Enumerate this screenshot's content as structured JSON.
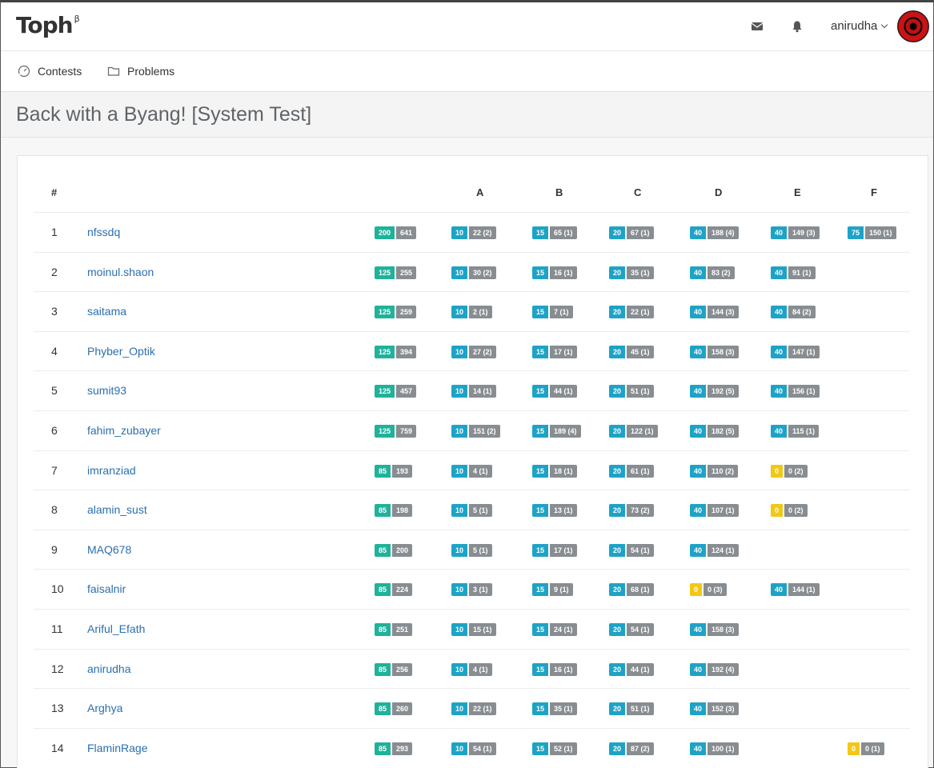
{
  "app": {
    "logo": "Toph",
    "logo_sup": "β",
    "username": "anirudha"
  },
  "nav": [
    {
      "label": "Contests",
      "icon": "gauge-icon"
    },
    {
      "label": "Problems",
      "icon": "folder-icon"
    }
  ],
  "page_title": "Back with a Byang! [System Test]",
  "table": {
    "headers": {
      "rank": "#",
      "problems": [
        "A",
        "B",
        "C",
        "D",
        "E",
        "F"
      ]
    },
    "rows": [
      {
        "rank": "1",
        "name": "nfssdq",
        "score": "200",
        "penalty": "641",
        "cells": [
          [
            "10",
            "22 (2)",
            "b"
          ],
          [
            "15",
            "65 (1)",
            "b"
          ],
          [
            "20",
            "67 (1)",
            "b"
          ],
          [
            "40",
            "188 (4)",
            "b"
          ],
          [
            "40",
            "149 (3)",
            "b"
          ],
          [
            "75",
            "150 (1)",
            "b"
          ]
        ]
      },
      {
        "rank": "2",
        "name": "moinul.shaon",
        "score": "125",
        "penalty": "255",
        "cells": [
          [
            "10",
            "30 (2)",
            "b"
          ],
          [
            "15",
            "16 (1)",
            "b"
          ],
          [
            "20",
            "35 (1)",
            "b"
          ],
          [
            "40",
            "83 (2)",
            "b"
          ],
          [
            "40",
            "91 (1)",
            "b"
          ],
          null
        ]
      },
      {
        "rank": "3",
        "name": "saitama",
        "score": "125",
        "penalty": "259",
        "cells": [
          [
            "10",
            "2 (1)",
            "b"
          ],
          [
            "15",
            "7 (1)",
            "b"
          ],
          [
            "20",
            "22 (1)",
            "b"
          ],
          [
            "40",
            "144 (3)",
            "b"
          ],
          [
            "40",
            "84 (2)",
            "b"
          ],
          null
        ]
      },
      {
        "rank": "4",
        "name": "Phyber_Optik",
        "score": "125",
        "penalty": "394",
        "cells": [
          [
            "10",
            "27 (2)",
            "b"
          ],
          [
            "15",
            "17 (1)",
            "b"
          ],
          [
            "20",
            "45 (1)",
            "b"
          ],
          [
            "40",
            "158 (3)",
            "b"
          ],
          [
            "40",
            "147 (1)",
            "b"
          ],
          null
        ]
      },
      {
        "rank": "5",
        "name": "sumit93",
        "score": "125",
        "penalty": "457",
        "cells": [
          [
            "10",
            "14 (1)",
            "b"
          ],
          [
            "15",
            "44 (1)",
            "b"
          ],
          [
            "20",
            "51 (1)",
            "b"
          ],
          [
            "40",
            "192 (5)",
            "b"
          ],
          [
            "40",
            "156 (1)",
            "b"
          ],
          null
        ]
      },
      {
        "rank": "6",
        "name": "fahim_zubayer",
        "score": "125",
        "penalty": "759",
        "cells": [
          [
            "10",
            "151 (2)",
            "b"
          ],
          [
            "15",
            "189 (4)",
            "b"
          ],
          [
            "20",
            "122 (1)",
            "b"
          ],
          [
            "40",
            "182 (5)",
            "b"
          ],
          [
            "40",
            "115 (1)",
            "b"
          ],
          null
        ]
      },
      {
        "rank": "7",
        "name": "imranziad",
        "score": "85",
        "penalty": "193",
        "cells": [
          [
            "10",
            "4 (1)",
            "b"
          ],
          [
            "15",
            "18 (1)",
            "b"
          ],
          [
            "20",
            "61 (1)",
            "b"
          ],
          [
            "40",
            "110 (2)",
            "b"
          ],
          [
            "0",
            "0 (2)",
            "y"
          ],
          null
        ]
      },
      {
        "rank": "8",
        "name": "alamin_sust",
        "score": "85",
        "penalty": "198",
        "cells": [
          [
            "10",
            "5 (1)",
            "b"
          ],
          [
            "15",
            "13 (1)",
            "b"
          ],
          [
            "20",
            "73 (2)",
            "b"
          ],
          [
            "40",
            "107 (1)",
            "b"
          ],
          [
            "0",
            "0 (2)",
            "y"
          ],
          null
        ]
      },
      {
        "rank": "9",
        "name": "MAQ678",
        "score": "85",
        "penalty": "200",
        "cells": [
          [
            "10",
            "5 (1)",
            "b"
          ],
          [
            "15",
            "17 (1)",
            "b"
          ],
          [
            "20",
            "54 (1)",
            "b"
          ],
          [
            "40",
            "124 (1)",
            "b"
          ],
          null,
          null
        ]
      },
      {
        "rank": "10",
        "name": "faisalnir",
        "score": "85",
        "penalty": "224",
        "cells": [
          [
            "10",
            "3 (1)",
            "b"
          ],
          [
            "15",
            "9 (1)",
            "b"
          ],
          [
            "20",
            "68 (1)",
            "b"
          ],
          [
            "0",
            "0 (3)",
            "y"
          ],
          [
            "40",
            "144 (1)",
            "b"
          ],
          null
        ]
      },
      {
        "rank": "11",
        "name": "Ariful_Efath",
        "score": "85",
        "penalty": "251",
        "cells": [
          [
            "10",
            "15 (1)",
            "b"
          ],
          [
            "15",
            "24 (1)",
            "b"
          ],
          [
            "20",
            "54 (1)",
            "b"
          ],
          [
            "40",
            "158 (3)",
            "b"
          ],
          null,
          null
        ]
      },
      {
        "rank": "12",
        "name": "anirudha",
        "score": "85",
        "penalty": "256",
        "cells": [
          [
            "10",
            "4 (1)",
            "b"
          ],
          [
            "15",
            "16 (1)",
            "b"
          ],
          [
            "20",
            "44 (1)",
            "b"
          ],
          [
            "40",
            "192 (4)",
            "b"
          ],
          null,
          null
        ]
      },
      {
        "rank": "13",
        "name": "Arghya",
        "score": "85",
        "penalty": "260",
        "cells": [
          [
            "10",
            "22 (1)",
            "b"
          ],
          [
            "15",
            "35 (1)",
            "b"
          ],
          [
            "20",
            "51 (1)",
            "b"
          ],
          [
            "40",
            "152 (3)",
            "b"
          ],
          null,
          null
        ]
      },
      {
        "rank": "14",
        "name": "FlaminRage",
        "score": "85",
        "penalty": "293",
        "cells": [
          [
            "10",
            "54 (1)",
            "b"
          ],
          [
            "15",
            "52 (1)",
            "b"
          ],
          [
            "20",
            "87 (2)",
            "b"
          ],
          [
            "40",
            "100 (1)",
            "b"
          ],
          null,
          [
            "0",
            "0 (1)",
            "y"
          ]
        ]
      }
    ]
  }
}
